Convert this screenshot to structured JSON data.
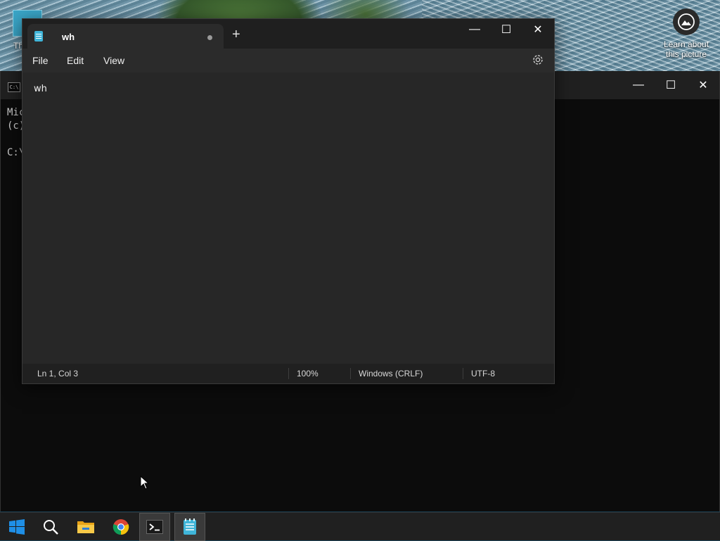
{
  "desktop": {
    "icon_label": "Th",
    "learn_about": "Learn about this picture"
  },
  "terminal": {
    "tab_icon_text": "C:\\",
    "lines": [
      "Mic",
      "(c)",
      "",
      "C:\\"
    ]
  },
  "notepad": {
    "tab_title": "wh",
    "menu": [
      "File",
      "Edit",
      "View"
    ],
    "content": "wh",
    "status": {
      "position": "Ln 1, Col 3",
      "zoom": "100%",
      "line_ending": "Windows (CRLF)",
      "encoding": "UTF-8"
    }
  },
  "window_controls": {
    "minimize": "—",
    "maximize": "☐",
    "close": "✕"
  },
  "taskbar": {
    "items": [
      "start",
      "search",
      "file-explorer",
      "chrome",
      "terminal",
      "notepad"
    ]
  }
}
